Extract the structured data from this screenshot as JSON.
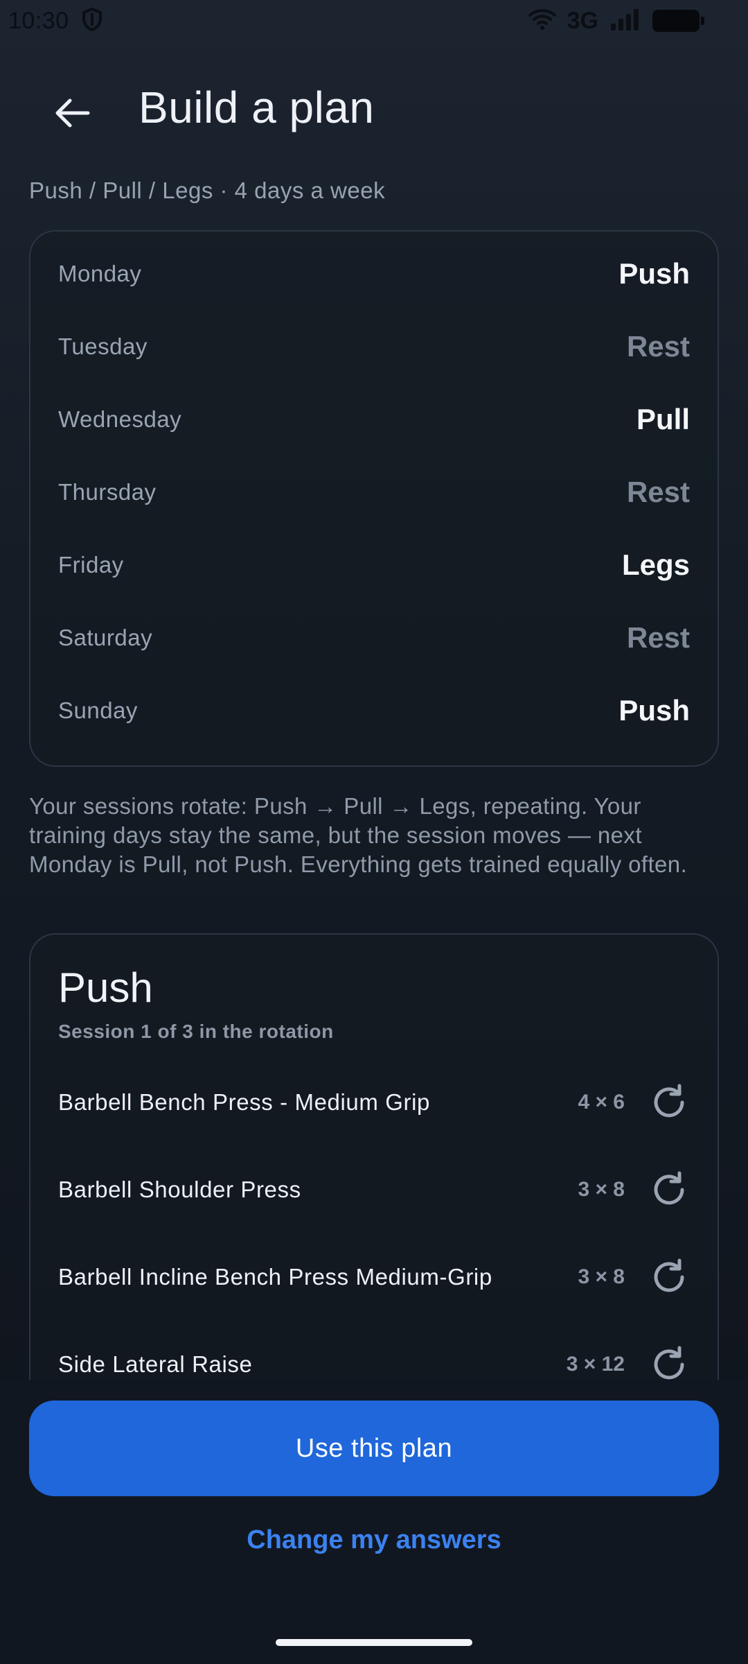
{
  "status_bar": {
    "time": "10:30",
    "network": "3G",
    "icons": [
      "shield-icon",
      "wifi-icon",
      "signal-icon",
      "battery-icon"
    ]
  },
  "header": {
    "title": "Build a plan",
    "back_icon": "arrow-left-icon"
  },
  "subtitle": "Push / Pull / Legs · 4 days a week",
  "schedule": [
    {
      "day": "Monday",
      "session": "Push",
      "rest": false
    },
    {
      "day": "Tuesday",
      "session": "Rest",
      "rest": true
    },
    {
      "day": "Wednesday",
      "session": "Pull",
      "rest": false
    },
    {
      "day": "Thursday",
      "session": "Rest",
      "rest": true
    },
    {
      "day": "Friday",
      "session": "Legs",
      "rest": false
    },
    {
      "day": "Saturday",
      "session": "Rest",
      "rest": true
    },
    {
      "day": "Sunday",
      "session": "Push",
      "rest": false
    }
  ],
  "description": "Your sessions rotate: Push → Pull → Legs, repeating. Your training days stay the same, but the session moves — next Monday is Pull, not Push. Everything gets trained equally often.",
  "session": {
    "title": "Push",
    "subtitle": "Session 1 of 3 in the rotation",
    "exercises": [
      {
        "name": "Barbell Bench Press - Medium Grip",
        "sets": "4 × 6"
      },
      {
        "name": "Barbell Shoulder Press",
        "sets": "3 × 8"
      },
      {
        "name": "Barbell Incline Bench Press Medium-Grip",
        "sets": "3 × 8"
      },
      {
        "name": "Side Lateral Raise",
        "sets": "3 × 12"
      }
    ],
    "swap_icon": "refresh-icon"
  },
  "actions": {
    "primary": "Use this plan",
    "secondary": "Change my answers"
  },
  "colors": {
    "accent": "#1f67da",
    "link": "#3b82f0",
    "rest": "#7d8795"
  }
}
